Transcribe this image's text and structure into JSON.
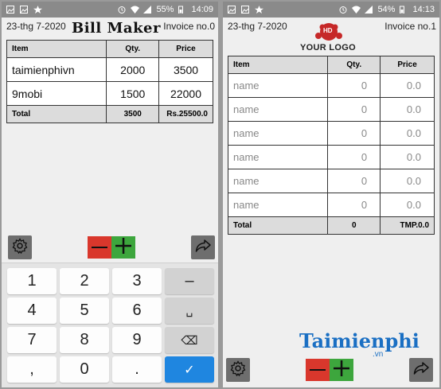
{
  "left": {
    "status": {
      "battery": "55%",
      "time": "14:09"
    },
    "date": "23-thg 7-2020",
    "title": "Bill Maker",
    "invoice": "Invoice no.0",
    "headers": [
      "Item",
      "Qty.",
      "Price"
    ],
    "rows": [
      {
        "item": "taimienphivn",
        "qty": "2000",
        "price": "3500"
      },
      {
        "item": "9mobi",
        "qty": "1500",
        "price": "22000"
      }
    ],
    "total": {
      "label": "Total",
      "qty": "3500",
      "price": "Rs.25500.0"
    },
    "keypad": {
      "keys": [
        "1",
        "2",
        "3",
        "–",
        "4",
        "5",
        "6",
        "␣",
        "7",
        "8",
        "9",
        "⌫",
        ",",
        "0",
        ".",
        "✓"
      ]
    }
  },
  "right": {
    "status": {
      "battery": "54%",
      "time": "14:13"
    },
    "date": "23-thg 7-2020",
    "invoice": "Invoice no.1",
    "logo": {
      "badge": "HD",
      "text": "YOUR LOGO"
    },
    "headers": [
      "Item",
      "Qty.",
      "Price"
    ],
    "rows": [
      {
        "item": "name",
        "qty": "0",
        "price": "0.0"
      },
      {
        "item": "name",
        "qty": "0",
        "price": "0.0"
      },
      {
        "item": "name",
        "qty": "0",
        "price": "0.0"
      },
      {
        "item": "name",
        "qty": "0",
        "price": "0.0"
      },
      {
        "item": "name",
        "qty": "0",
        "price": "0.0"
      },
      {
        "item": "name",
        "qty": "0",
        "price": "0.0"
      }
    ],
    "total": {
      "label": "Total",
      "qty": "0",
      "price": "TMP.0.0"
    },
    "watermark": {
      "text": "Taimienphi",
      "suffix": ".vn"
    }
  },
  "colors": {
    "minus": "#d9372c",
    "plus": "#3da63d",
    "confirm": "#1f86e0"
  }
}
